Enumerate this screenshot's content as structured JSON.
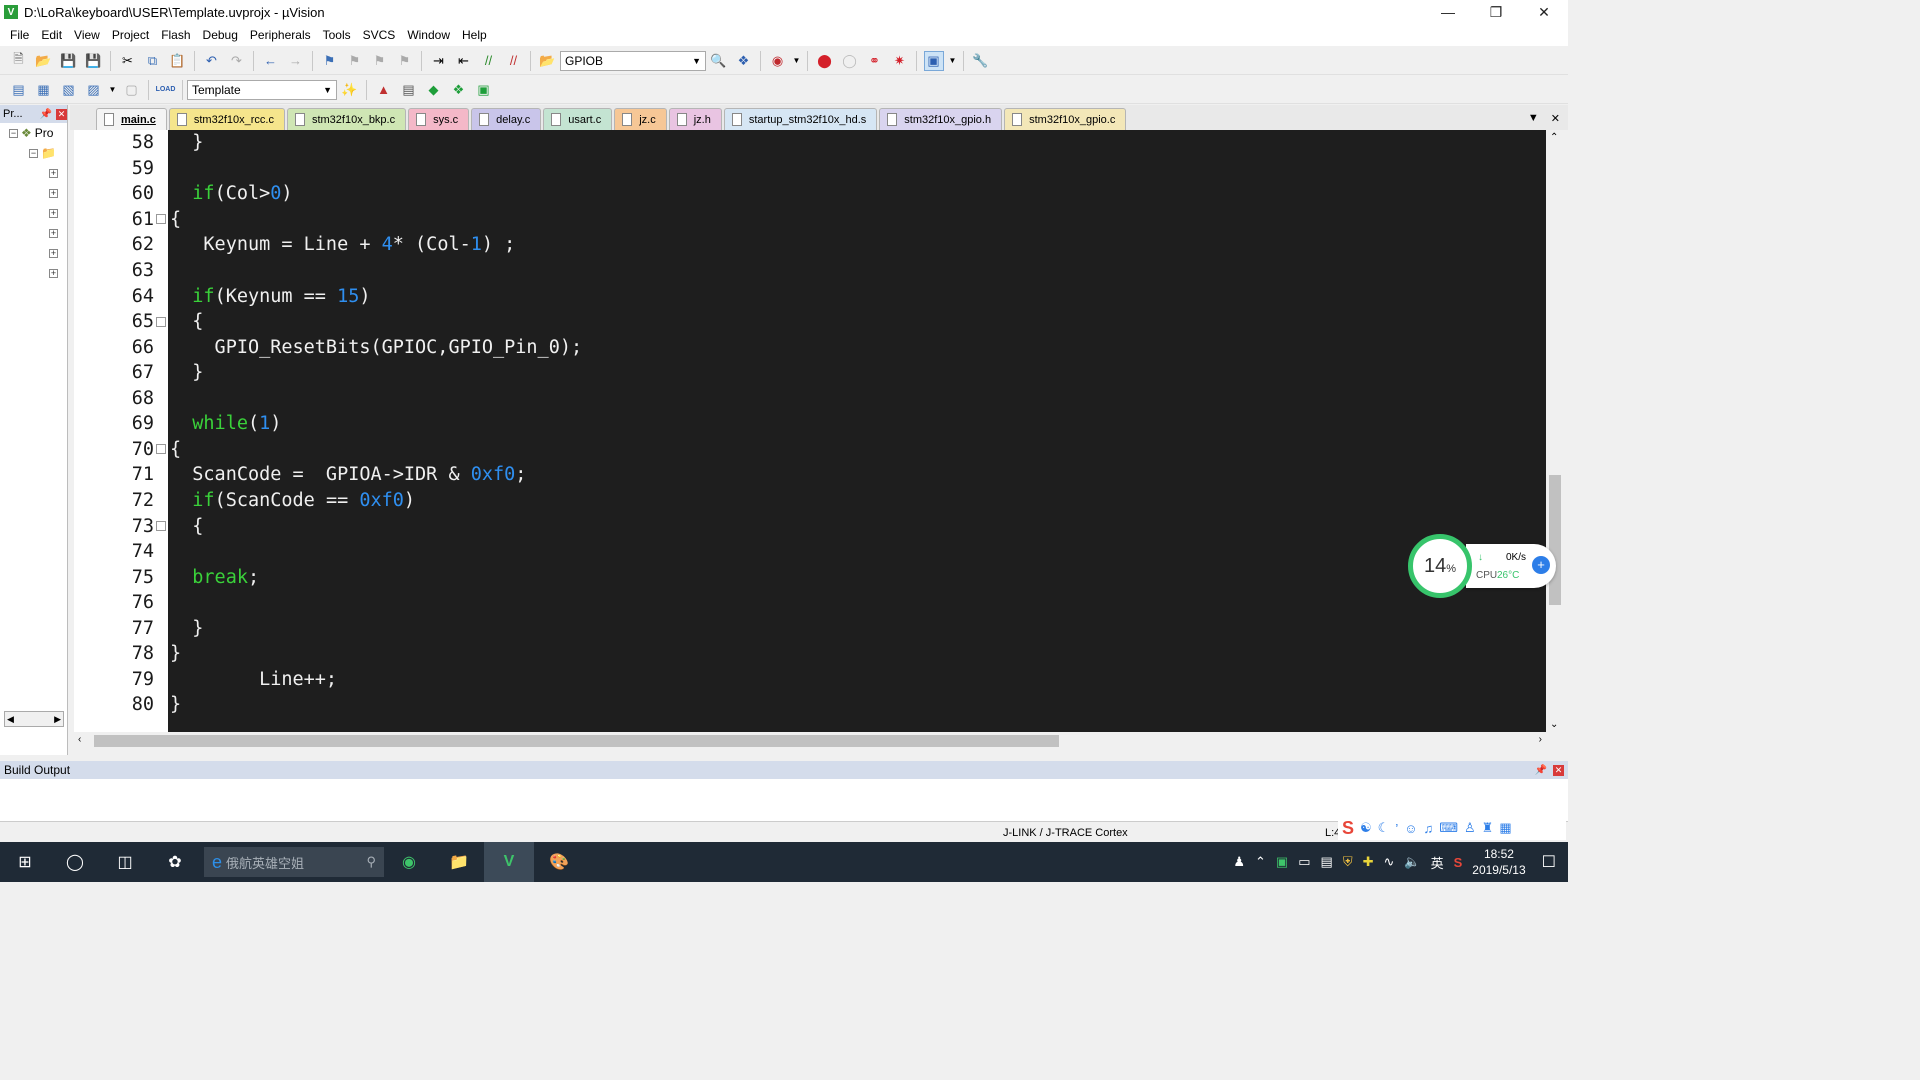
{
  "window": {
    "title": "D:\\LoRa\\keyboard\\USER\\Template.uvprojx - µVision"
  },
  "menu": [
    "File",
    "Edit",
    "View",
    "Project",
    "Flash",
    "Debug",
    "Peripherals",
    "Tools",
    "SVCS",
    "Window",
    "Help"
  ],
  "toolbar": {
    "find_combo": "GPIOB",
    "target_combo": "Template",
    "load_label": "LOAD"
  },
  "project_pane": {
    "header": "Pr...",
    "root_label": "Pro"
  },
  "tabs": [
    {
      "label": "main.c",
      "active": true,
      "color": "#f4f4f4"
    },
    {
      "label": "stm32f10x_rcc.c",
      "color": "#f5e58c"
    },
    {
      "label": "stm32f10x_bkp.c",
      "color": "#cfe6b4"
    },
    {
      "label": "sys.c",
      "color": "#f4b8c8"
    },
    {
      "label": "delay.c",
      "color": "#c9c5ea"
    },
    {
      "label": "usart.c",
      "color": "#c4e4d2"
    },
    {
      "label": "jz.c",
      "color": "#f6c796"
    },
    {
      "label": "jz.h",
      "color": "#e9c4e2"
    },
    {
      "label": "startup_stm32f10x_hd.s",
      "color": "#d6e6f4"
    },
    {
      "label": "stm32f10x_gpio.h",
      "color": "#d9d4ef"
    },
    {
      "label": "stm32f10x_gpio.c",
      "color": "#f3e7b8"
    }
  ],
  "code_lines": [
    {
      "n": "58",
      "code": "  }"
    },
    {
      "n": "59",
      "code": ""
    },
    {
      "n": "60",
      "code": "  if(Col>0)"
    },
    {
      "n": "61",
      "code": "{"
    },
    {
      "n": "62",
      "code": "   Keynum = Line + 4* (Col-1) ;"
    },
    {
      "n": "63",
      "code": ""
    },
    {
      "n": "64",
      "code": "  if(Keynum == 15)"
    },
    {
      "n": "65",
      "code": "  {"
    },
    {
      "n": "66",
      "code": "    GPIO_ResetBits(GPIOC,GPIO_Pin_0);"
    },
    {
      "n": "67",
      "code": "  }"
    },
    {
      "n": "68",
      "code": ""
    },
    {
      "n": "69",
      "code": "  while(1)"
    },
    {
      "n": "70",
      "code": "{"
    },
    {
      "n": "71",
      "code": "  ScanCode =  GPIOA->IDR & 0xf0;"
    },
    {
      "n": "72",
      "code": "  if(ScanCode == 0xf0)"
    },
    {
      "n": "73",
      "code": "  {"
    },
    {
      "n": "74",
      "code": ""
    },
    {
      "n": "75",
      "code": "  break;"
    },
    {
      "n": "76",
      "code": ""
    },
    {
      "n": "77",
      "code": "  }"
    },
    {
      "n": "78",
      "code": "}"
    },
    {
      "n": "79",
      "code": "        Line++;"
    },
    {
      "n": "80",
      "code": "}"
    }
  ],
  "build_output": {
    "title": "Build Output"
  },
  "status": {
    "debugger": "J-LINK / J-TRACE Cortex",
    "pos": "L:4"
  },
  "cpu_widget": {
    "percent": "14",
    "unit": "%",
    "net": "0K/s",
    "cpu_label": "CPU",
    "temp": "26°C"
  },
  "taskbar": {
    "search_placeholder": "俄航英雄空姐",
    "time": "18:52",
    "date": "2019/5/13",
    "ime": "英"
  }
}
